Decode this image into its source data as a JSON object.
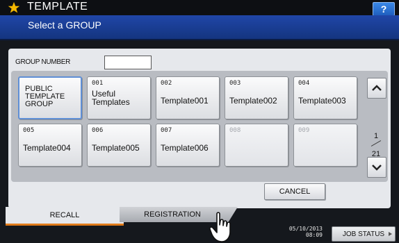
{
  "header": {
    "title": "TEMPLATE",
    "subtitle": "Select a GROUP",
    "help_label": "?",
    "star_color": "#f5b800"
  },
  "group_number": {
    "label": "GROUP NUMBER",
    "value": ""
  },
  "groups": [
    {
      "number": "",
      "name": "PUBLIC\nTEMPLATE\nGROUP",
      "state": "selected"
    },
    {
      "number": "001",
      "name": "Useful\nTemplates",
      "state": "normal"
    },
    {
      "number": "002",
      "name": "Template001",
      "state": "normal"
    },
    {
      "number": "003",
      "name": "Template002",
      "state": "normal"
    },
    {
      "number": "004",
      "name": "Template003",
      "state": "normal"
    },
    {
      "number": "005",
      "name": "Template004",
      "state": "normal"
    },
    {
      "number": "006",
      "name": "Template005",
      "state": "normal"
    },
    {
      "number": "007",
      "name": "Template006",
      "state": "normal"
    },
    {
      "number": "008",
      "name": "",
      "state": "disabled"
    },
    {
      "number": "009",
      "name": "",
      "state": "disabled"
    }
  ],
  "pagination": {
    "current": "1",
    "total": "21",
    "up_icon": "chevron-up-icon",
    "down_icon": "chevron-down-icon"
  },
  "actions": {
    "cancel_label": "CANCEL"
  },
  "tabs": [
    {
      "label": "RECALL",
      "active": true
    },
    {
      "label": "REGISTRATION",
      "active": false
    }
  ],
  "footer": {
    "date": "05/10/2013",
    "time": "08:09",
    "job_status_label": "JOB STATUS"
  },
  "colors": {
    "accent": "#e07b1b",
    "header_blue": "#1c3f98",
    "selected_border": "#5f8fd6"
  }
}
